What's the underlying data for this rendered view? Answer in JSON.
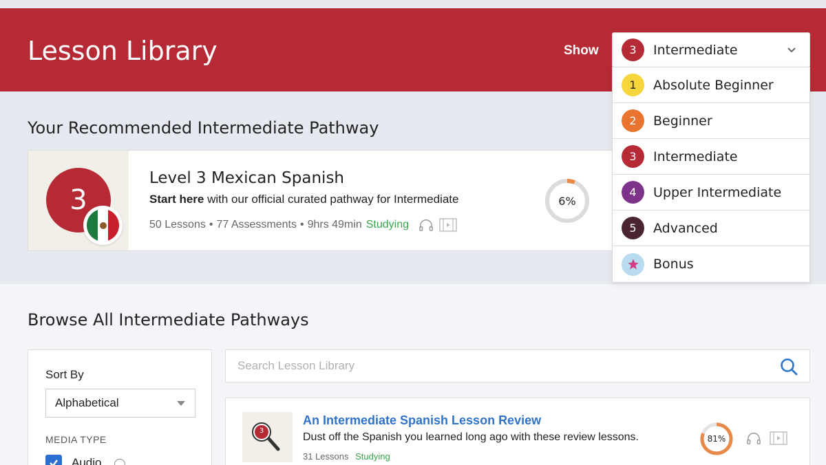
{
  "header": {
    "title": "Lesson Library",
    "show_label": "Show",
    "selected": {
      "number": "3",
      "label": "Intermediate",
      "color": "#b52a35"
    }
  },
  "dropdown": {
    "options": [
      {
        "number": "1",
        "label": "Absolute Beginner",
        "color": "#f6d63c",
        "text_color": "#222"
      },
      {
        "number": "2",
        "label": "Beginner",
        "color": "#e8742f",
        "text_color": "#fff"
      },
      {
        "number": "3",
        "label": "Intermediate",
        "color": "#b52a35",
        "text_color": "#fff"
      },
      {
        "number": "4",
        "label": "Upper Intermediate",
        "color": "#7d3389",
        "text_color": "#fff"
      },
      {
        "number": "5",
        "label": "Advanced",
        "color": "#4a2431",
        "text_color": "#fff"
      },
      {
        "number": "",
        "label": "Bonus",
        "color": "#b9dbf0",
        "text_color": "#d03e86",
        "icon": "star-icon"
      }
    ]
  },
  "recommended": {
    "section_title": "Your Recommended Intermediate Pathway",
    "badge_number": "3",
    "title": "Level 3 Mexican Spanish",
    "desc_bold": "Start here",
    "desc_rest": " with our official curated pathway for Intermediate",
    "lessons": "50 Lessons",
    "assessments": "77 Assessments",
    "duration": "9hrs 49min",
    "status": "Studying",
    "progress_text": "6%",
    "progress": 0.06
  },
  "browse": {
    "section_title": "Browse All Intermediate Pathways",
    "sort_label": "Sort By",
    "sort_value": "Alphabetical",
    "media_type_label": "MEDIA TYPE",
    "audio_label": "Audio",
    "search_placeholder": "Search Lesson Library"
  },
  "lesson": {
    "badge_number": "3",
    "title": "An Intermediate Spanish Lesson Review",
    "desc": "Dust off the Spanish you learned long ago with these review lessons.",
    "lessons": "31 Lessons",
    "status": "Studying",
    "progress_text": "81%",
    "progress": 0.81
  },
  "colors": {
    "brand_red": "#b52a35",
    "studying_green": "#3aa54a",
    "link_blue": "#2f73c9",
    "ring_orange": "#e8894a"
  }
}
